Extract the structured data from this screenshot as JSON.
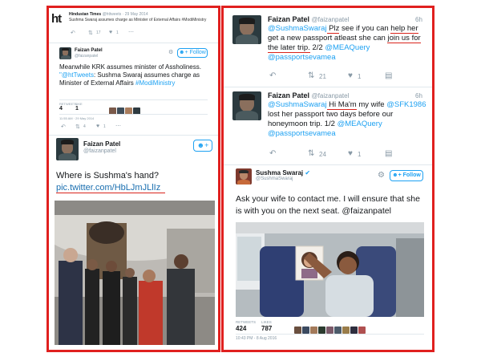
{
  "left": {
    "ht_tweet": {
      "logo": "ht",
      "account": "Hindustan Times",
      "handle": "@httweets",
      "time": "· 29 May 2014",
      "text": "Sushma Swaraj assumes charge as Minister of External Affairs #ModiMinistry",
      "reply_count": "",
      "retweet_count": "17",
      "like_count": "1"
    },
    "quote_tweet": {
      "name": "Faizan Patel",
      "handle": "@faizanpatel",
      "follow_label": "Follow",
      "text_main": "Meanwhile KRK assumes minister of Assholiness. ",
      "text_quote_mention": "\"@htTweets",
      "text_quote_rest": ": Sushma Swaraj assumes charge as Minister of External Affairs ",
      "hashtag": "#ModiMinistry",
      "retweets_label": "RETWEETS",
      "likes_label": "LIKE",
      "retweets": "4",
      "likes": "1",
      "timestamp": "11:55 AM · 29 May 2014",
      "footer_retweets": "4",
      "footer_likes": "1"
    },
    "hand_tweet": {
      "name": "Faizan Patel",
      "handle": "@faizanpatel",
      "text": "Where is Sushma's hand?",
      "link": "pic.twitter.com/HbLJmJLlIz"
    }
  },
  "right": {
    "tweet1": {
      "name": "Faizan Patel",
      "handle": "@faizanpatel",
      "time": "6h",
      "mention": "@SushmaSwaraj",
      "text_a": " Plz",
      "text_b": " see if you can ",
      "text_c": "help her",
      "text_d": " get a new passport atleast she can ",
      "text_e": "join us for the later trip.",
      "text_f": " 2/2 ",
      "tag1": "@MEAQuery",
      "tag2": "@passportsevamea",
      "retweets": "21",
      "likes": "1"
    },
    "tweet2": {
      "name": "Faizan Patel",
      "handle": "@faizanpatel",
      "time": "6h",
      "mention": "@SushmaSwaraj",
      "text_a": " Hi Ma'm",
      "text_b": " my wife ",
      "tag1": "@SFK1986",
      "text_c": " lost her passport two days before our honeymoon trip. 1/2 ",
      "tag2": "@MEAQuery",
      "tag3": "@passportsevamea",
      "retweets": "24",
      "likes": "1"
    },
    "reply": {
      "name": "Sushma Swaraj",
      "handle": "@SushmaSwaraj",
      "follow_label": "Follow",
      "text": "Ask your wife to contact me. I will ensure that she is with you on the next seat. @faizanpatel",
      "retweets_label": "RETWEETS",
      "likes_label": "LIKES",
      "retweets": "424",
      "likes": "787",
      "timestamp": "10:43 PM - 8 Aug 2016"
    }
  }
}
